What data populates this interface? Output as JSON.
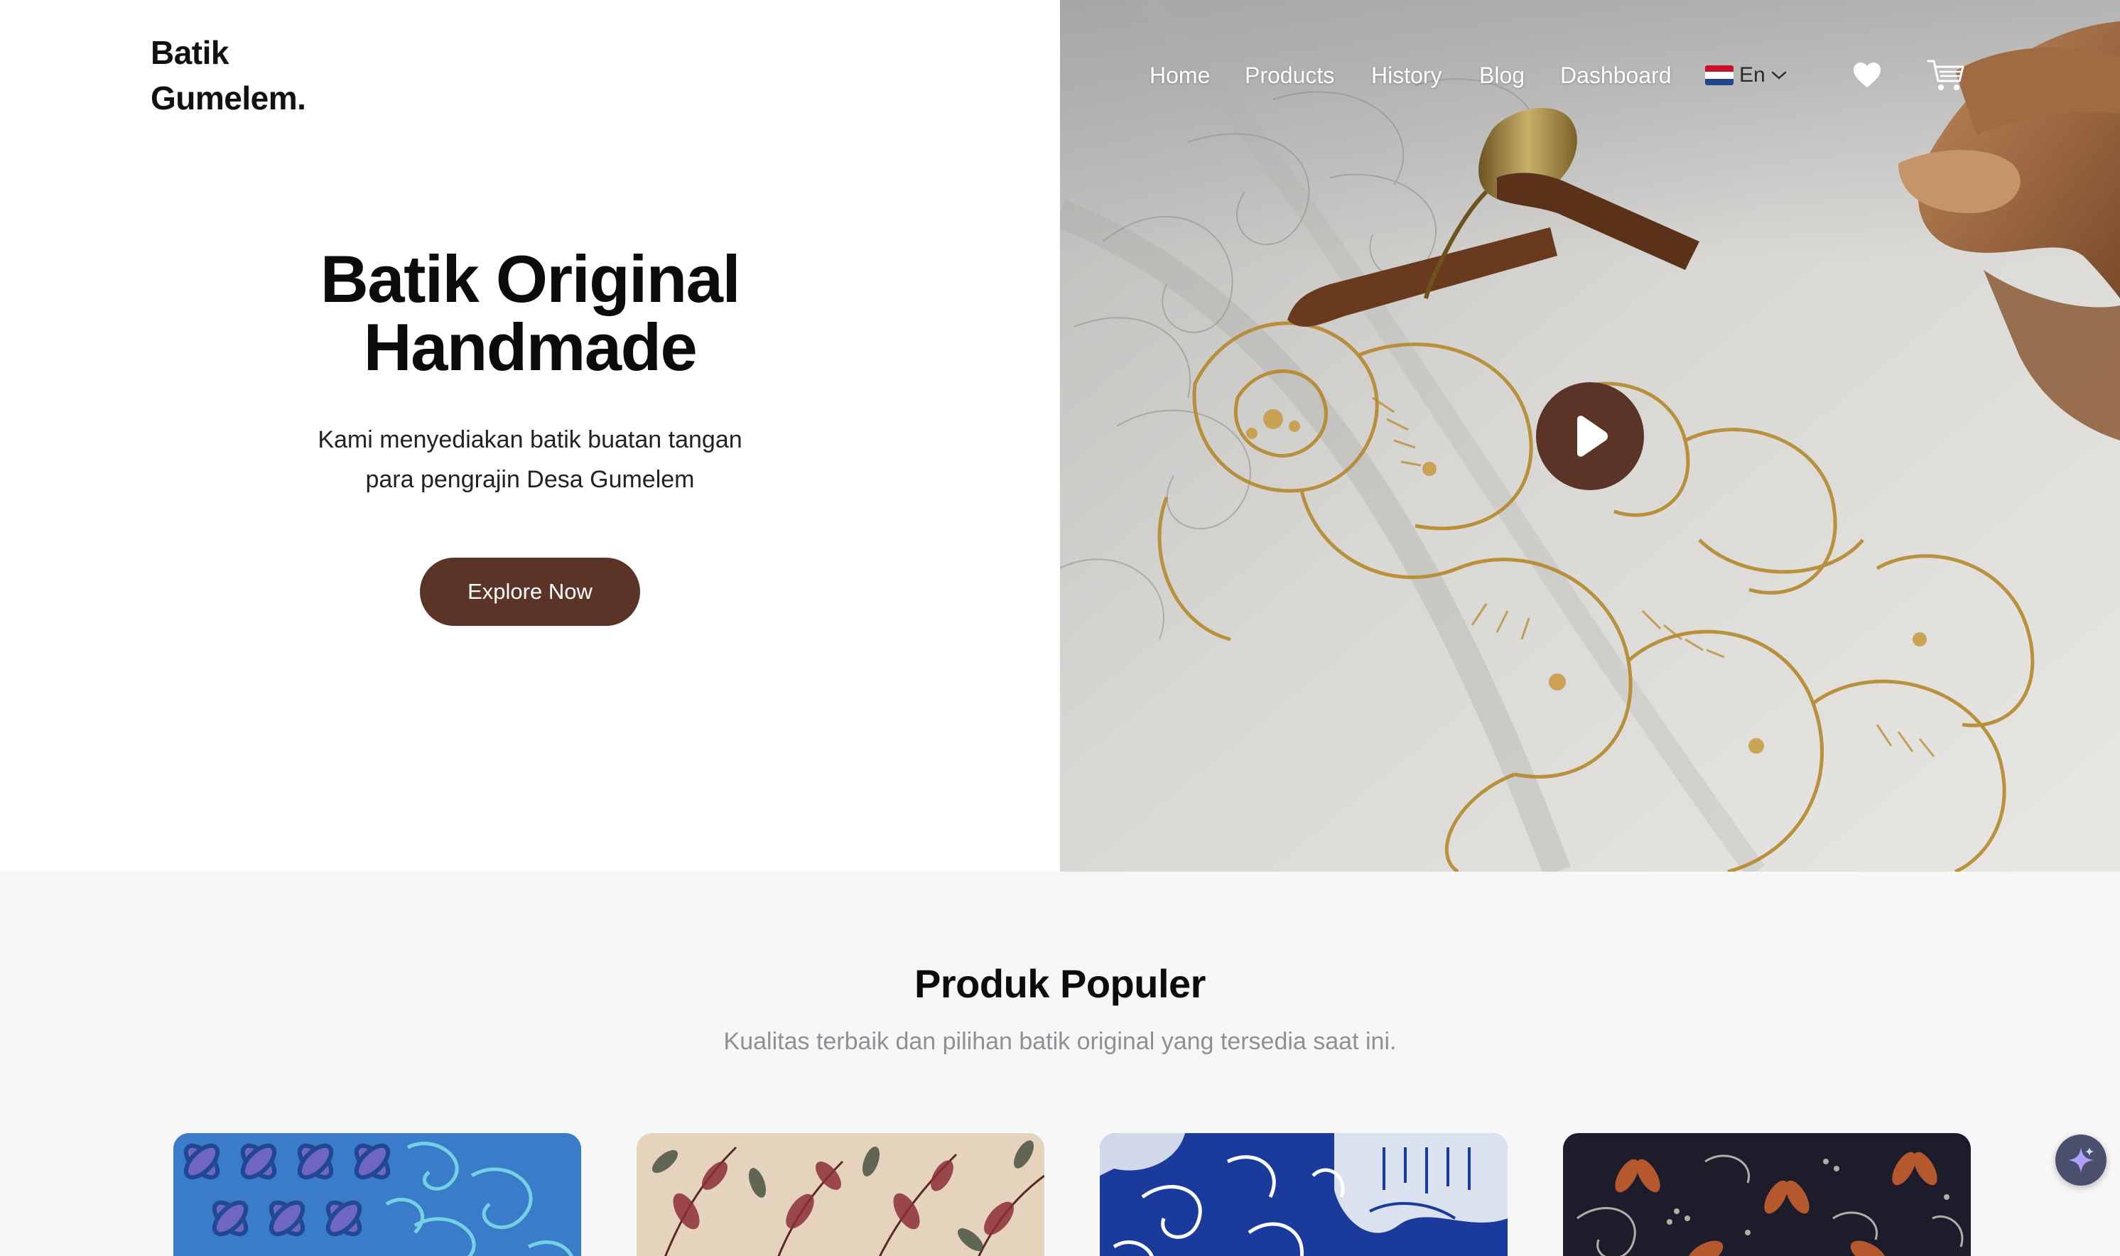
{
  "brand": {
    "line1": "Batik",
    "line2": "Gumelem."
  },
  "nav": {
    "items": [
      {
        "label": "Home"
      },
      {
        "label": "Products"
      },
      {
        "label": "History"
      },
      {
        "label": "Blog"
      },
      {
        "label": "Dashboard"
      }
    ],
    "language": {
      "label": "En",
      "flag_icon": "netherlands-flag-icon"
    },
    "wishlist_icon": "heart-icon",
    "cart_icon": "cart-icon"
  },
  "hero": {
    "title_line1": "Batik Original",
    "title_line2": "Handmade",
    "subtitle_line1": "Kami menyediakan batik buatan tangan",
    "subtitle_line2": "para pengrajin Desa Gumelem",
    "cta_label": "Explore Now",
    "video_icon": "play-icon"
  },
  "popular": {
    "title": "Produk Populer",
    "subtitle": "Kualitas terbaik dan pilihan batik original yang tersedia saat ini.",
    "cards": [
      {
        "name": "blue-kawung-batik"
      },
      {
        "name": "cream-floral-batik"
      },
      {
        "name": "indigo-white-batik"
      },
      {
        "name": "dark-floral-batik"
      }
    ]
  },
  "assistant": {
    "icon": "sparkle-icon"
  },
  "colors": {
    "accent": "#5b3427",
    "section_bg": "#f7f7f7",
    "muted_text": "#8d9196"
  }
}
